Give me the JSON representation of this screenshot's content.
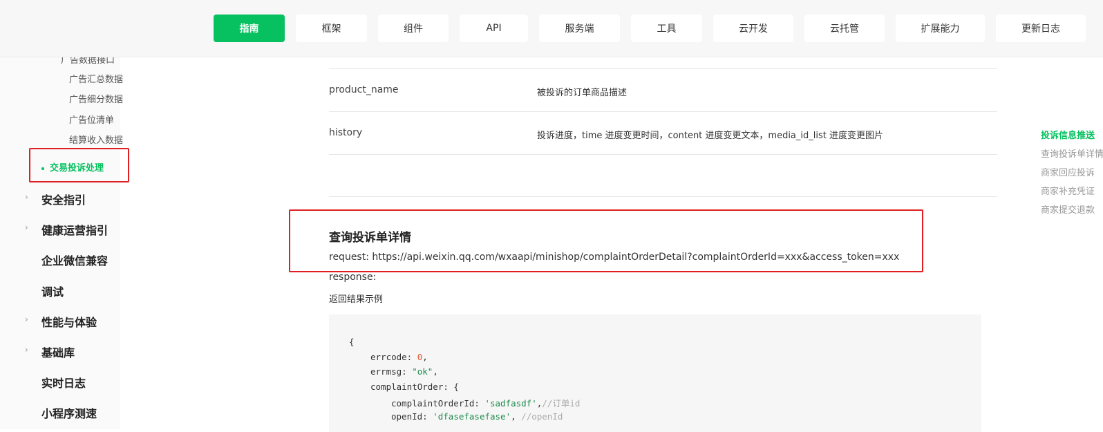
{
  "nav": {
    "items": [
      "指南",
      "框架",
      "组件",
      "API",
      "服务端",
      "工具",
      "云开发",
      "云托管",
      "扩展能力",
      "更新日志"
    ],
    "active_index": 0,
    "accent": "#07c160"
  },
  "sidebar": {
    "group_title": "广告数据接口",
    "sub_items": [
      "广告汇总数据",
      "广告细分数据",
      "广告位清单",
      "结算收入数据"
    ],
    "active_item": "交易投诉处理",
    "sections": [
      {
        "label": "安全指引",
        "expandable": true
      },
      {
        "label": "健康运营指引",
        "expandable": true
      },
      {
        "label": "企业微信兼容",
        "expandable": false
      },
      {
        "label": "调试",
        "expandable": false
      },
      {
        "label": "性能与体验",
        "expandable": true
      },
      {
        "label": "基础库",
        "expandable": true
      },
      {
        "label": "实时日志",
        "expandable": false
      },
      {
        "label": "小程序测速",
        "expandable": false
      }
    ]
  },
  "content": {
    "table_rows": [
      {
        "key": "product_name",
        "value": "被投诉的订单商品描述"
      },
      {
        "key": "history",
        "value": "投诉进度，time 进度变更时间，content 进度变更文本，media_id_list 进度变更图片"
      }
    ],
    "section_title": "查询投诉单详情",
    "request_line": "request: https://api.weixin.qq.com/wxaapi/minishop/complaintOrderDetail?complaintOrderId=xxx&access_token=xxx",
    "response_line": "response:",
    "example_label": "返回结果示例",
    "code": {
      "open_brace": "{",
      "errcode_key": "errcode: ",
      "errcode_val": "0",
      "errmsg_key": "errmsg: ",
      "errmsg_val": "\"ok\"",
      "order_key": "complaintOrder: {",
      "order_id_key": "complaintOrderId: ",
      "order_id_val": "'sadfasdf'",
      "order_id_cmt": "//订单id",
      "openid_key": "openId: ",
      "openid_val": "'dfasefasefase'",
      "openid_cmt": " //openId"
    }
  },
  "toc": {
    "items": [
      "投诉信息推送",
      "查询投诉单详情",
      "商家回应投诉",
      "商家补充凭证",
      "商家提交退款"
    ],
    "current_index": 0
  }
}
